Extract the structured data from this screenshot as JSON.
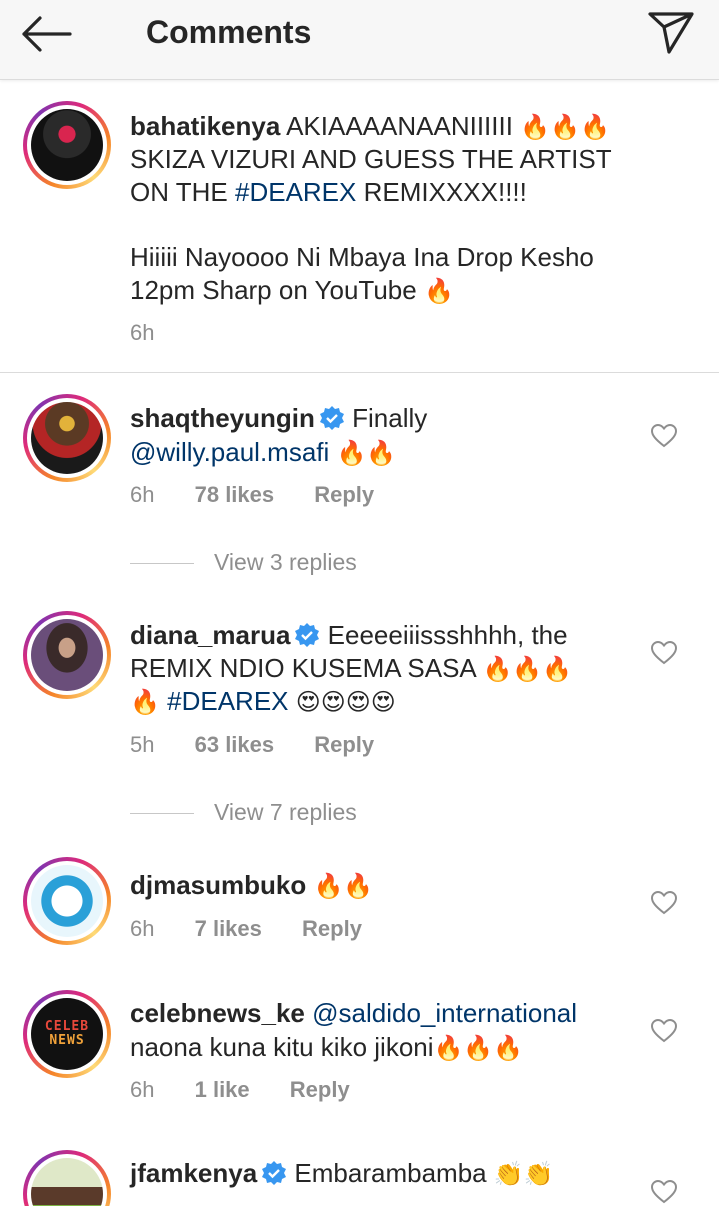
{
  "header": {
    "title": "Comments",
    "back_icon": "arrow-left-icon",
    "share_icon": "paper-plane-icon"
  },
  "caption": {
    "username": "bahatikenya",
    "text_1": "AKIAAAANAANIIIIII",
    "fire_1": "🔥🔥🔥",
    "text_2": "SKIZA VIZURI AND GUESS THE ARTIST",
    "text_3a": "ON THE ",
    "hashtag": "#DEAREX",
    "text_3b": " REMIXXXX!!!!",
    "text_4": "Hiiiii Nayoooo Ni Mbaya Ina Drop Kesho",
    "text_5": "12pm Sharp on YouTube",
    "fire_2": "🔥",
    "time": "6h"
  },
  "comments": [
    {
      "username": "shaqtheyungin",
      "text_1": "Finally",
      "mention": "@willy.paul.msafi",
      "fire": "🔥🔥",
      "time": "6h",
      "likes": "78 likes",
      "reply": "Reply",
      "view_replies": "View 3 replies"
    },
    {
      "username": "diana_marua",
      "text_1": "Eeeeeiiissshhhh, the",
      "text_2": "REMIX NDIO KUSEMA SASA",
      "fire_a": "🔥🔥🔥",
      "fire_b": "🔥",
      "hashtag": "#DEAREX",
      "hearts": "😍😍😍😍",
      "time": "5h",
      "likes": "63 likes",
      "reply": "Reply",
      "view_replies": "View 7 replies"
    },
    {
      "username": "djmasumbuko",
      "fire": "🔥🔥",
      "time": "6h",
      "likes": "7 likes",
      "reply": "Reply"
    },
    {
      "username": "celebnews_ke",
      "mention": "@saldido_international",
      "text_2": "naona kuna kitu kiko jikoni",
      "fire": "🔥🔥🔥",
      "avatar_text_1": "CELEB",
      "avatar_text_2": "NEWS",
      "time": "6h",
      "likes": "1 like",
      "reply": "Reply"
    },
    {
      "username": "jfamkenya",
      "text_1": "Embarambamba",
      "clap": "👏👏"
    }
  ],
  "colors": {
    "link": "#003569",
    "muted": "#8e8e8e",
    "verified": "#3897f0",
    "fire": "#ff8c00"
  }
}
